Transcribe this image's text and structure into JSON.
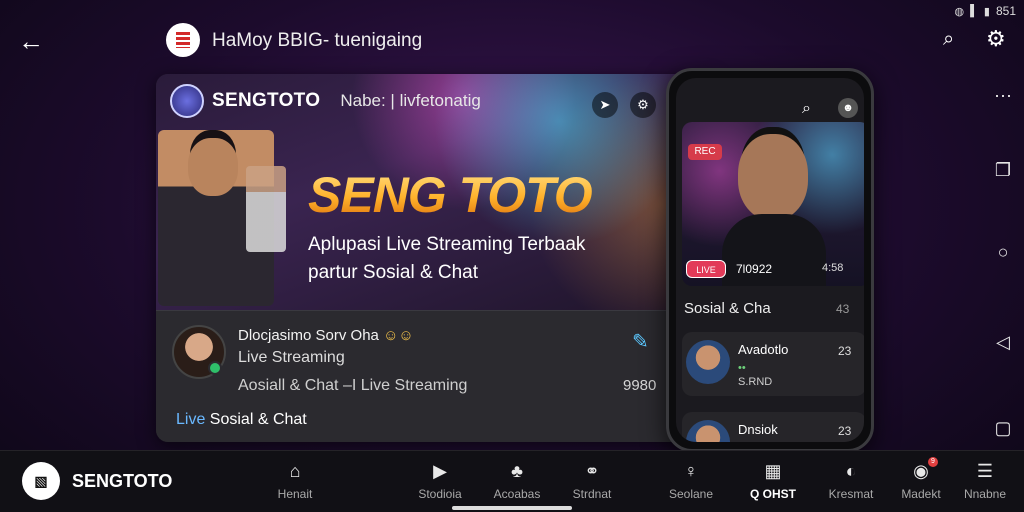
{
  "status_bar": {
    "time": "851",
    "icons": [
      "wifi-icon",
      "signal-icon",
      "battery-icon"
    ]
  },
  "topbar": {
    "title": "HaMoy BBIG- tuenigaing"
  },
  "card": {
    "brand_name": "SENGTOTO",
    "brand_subtitle": "Nabe: | livfetonatig",
    "hero_title": "SENG TOTO",
    "tagline_line1": "Aplupasi Live Streaming Terbaak",
    "tagline_line2": "partur Sosial & Chat",
    "host_name": "Dlocjasimo Sorv Oha",
    "host_role": "Live Streaming",
    "host_categories": "Aosiall & Chat –I Live Streaming",
    "host_count": "9980",
    "footer_highlight": "Live",
    "footer_text": " Sosial & Chat"
  },
  "phone": {
    "rec_label": "REC",
    "badge_label": "LIVE",
    "time_left": "7l0922",
    "time_right": "4:58",
    "section_title": "Sosial & Cha",
    "section_icon": "43",
    "chats": [
      {
        "name": "Avadotlo",
        "num": "23",
        "msg": "•• ",
        "msg2": "S.RND"
      },
      {
        "name": "Dnsiok",
        "num": "23",
        "msg": "••• •",
        "msg2": ""
      }
    ]
  },
  "bottom": {
    "brand": "SENGTOTO",
    "tabs": [
      {
        "label": "Henait",
        "icon": "⌂"
      },
      {
        "label": "Stodioia",
        "icon": "▶"
      },
      {
        "label": "Acoabas",
        "icon": "♣"
      },
      {
        "label": "Strdnat",
        "icon": "⚭"
      },
      {
        "label": "Seolane",
        "icon": "♀"
      },
      {
        "label": "Q OHST",
        "icon": "▦"
      },
      {
        "label": "Kresmat",
        "icon": "◐"
      },
      {
        "label": "Madekt",
        "icon": "◉"
      },
      {
        "label": "Nnabne",
        "icon": "☰"
      }
    ],
    "badge_count": "9"
  },
  "colors": {
    "accent": "#5cc8ff",
    "live_red": "#e23a58",
    "background": "#1c0b2c"
  }
}
